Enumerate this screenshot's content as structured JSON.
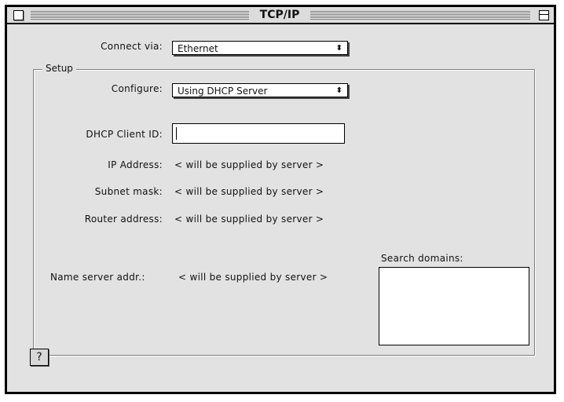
{
  "window": {
    "title": "TCP/IP"
  },
  "connect": {
    "label": "Connect via:",
    "value": "Ethernet"
  },
  "setup": {
    "group_label": "Setup",
    "configure_label": "Configure:",
    "configure_value": "Using DHCP Server",
    "dhcp_client_id_label": "DHCP Client ID:",
    "dhcp_client_id_value": "",
    "ip_label": "IP Address:",
    "ip_value": "< will be supplied by server >",
    "subnet_label": "Subnet mask:",
    "subnet_value": "< will be supplied by server >",
    "router_label": "Router address:",
    "router_value": "< will be supplied by server >",
    "nameserver_label": "Name server addr.:",
    "nameserver_value": "< will be supplied by server >",
    "search_domains_label": "Search domains:"
  },
  "icons": {
    "popup_arrow": "updown-arrows-icon",
    "help": "question-mark-icon"
  }
}
